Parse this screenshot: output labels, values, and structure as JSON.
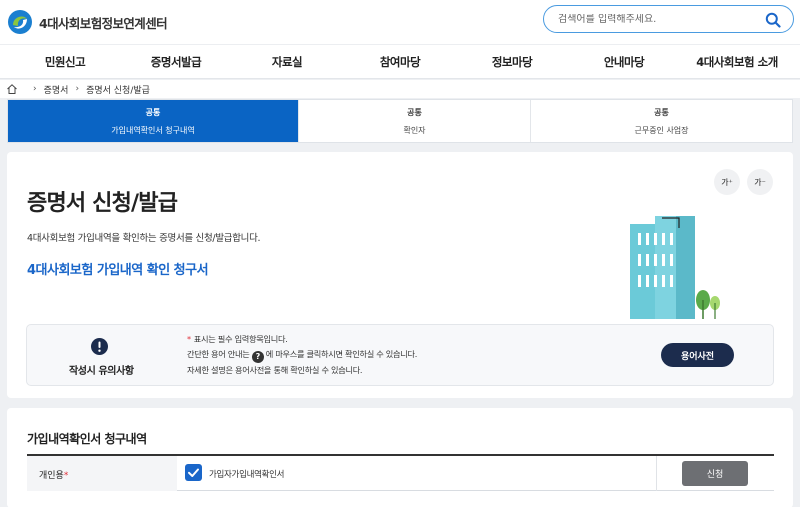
{
  "header": {
    "logo_text": "4대사회보험정보연계센터",
    "search_placeholder": "검색어를 입력해주세요."
  },
  "nav": {
    "items": [
      "민원신고",
      "증명서발급",
      "자료실",
      "참여마당",
      "정보마당",
      "안내마당",
      "4대사회보험 소개"
    ]
  },
  "breadcrumb": {
    "items": [
      "증명서",
      "증명서 신청/발급"
    ]
  },
  "tabs": [
    {
      "top": "공통",
      "label": "가입내역확인서 청구내역",
      "active": true
    },
    {
      "top": "공통",
      "label": "확인자",
      "active": false
    },
    {
      "top": "공통",
      "label": "근무중인 사업장",
      "active": false
    }
  ],
  "font_controls": {
    "increase": "가⁺",
    "decrease": "가⁻"
  },
  "main": {
    "title": "증명서 신청/발급",
    "description": "4대사회보험 가입내역을 확인하는 증명서를 신청/발급합니다.",
    "doc_title": "4대사회보험 가입내역 확인 청구서"
  },
  "notice": {
    "label": "작성시 유의사항",
    "line1": "표시는 필수 입력항목입니다.",
    "line2_pre": "간단한 용어 안내는",
    "line2_post": "에 마우스를 클릭하시면 확인하실 수 있습니다.",
    "line3": "자세한 설명은 용어사전을 통해 확인하실 수 있습니다.",
    "dict_button": "용어사전"
  },
  "form": {
    "title": "가입내역확인서 청구내역",
    "row_label": "개인용",
    "row_required": "*",
    "checkbox_label": "가입자가입내역확인서",
    "checked": true,
    "apply_button": "신청"
  },
  "colors": {
    "primary": "#0a64c4",
    "doc_title": "#1a66c9",
    "dict_button": "#1c2c4d",
    "required": "#e0303a"
  }
}
